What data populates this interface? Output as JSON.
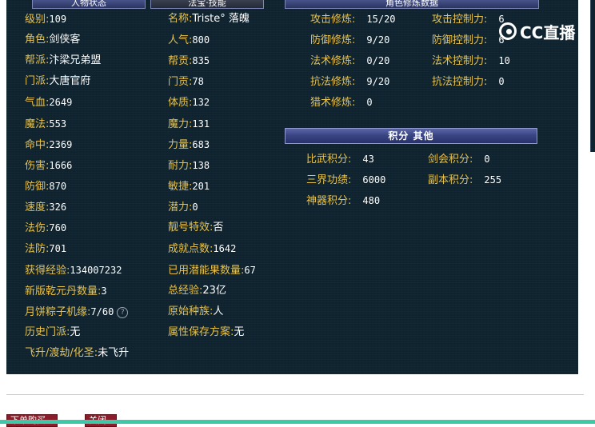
{
  "tabs": [
    {
      "label": "人物状态"
    },
    {
      "label": "法宝·技能"
    },
    {
      "label": "角色修炼数据"
    }
  ],
  "watermark": "CC直播",
  "basic_stats": [
    {
      "label": "级别:",
      "value": "109"
    },
    {
      "label": "角色:",
      "value": "剑侠客"
    },
    {
      "label": "帮派:",
      "value": "汴梁兄弟盟"
    },
    {
      "label": "门派:",
      "value": "大唐官府"
    },
    {
      "label": "气血:",
      "value": "2649"
    },
    {
      "label": "魔法:",
      "value": "553"
    },
    {
      "label": "命中:",
      "value": "2369"
    },
    {
      "label": "伤害:",
      "value": "1666"
    },
    {
      "label": "防御:",
      "value": "870"
    },
    {
      "label": "速度:",
      "value": "326"
    },
    {
      "label": "法伤:",
      "value": "760"
    },
    {
      "label": "法防:",
      "value": "701"
    },
    {
      "label": "获得经验:",
      "value": "134007232"
    },
    {
      "label": "新版乾元丹数量:",
      "value": "3"
    },
    {
      "label": "月饼粽子机缘:",
      "value": "7/60"
    },
    {
      "label": "历史门派:",
      "value": "无"
    },
    {
      "label": "飞升/渡劫/化圣:",
      "value": "未飞升"
    }
  ],
  "detail_stats": [
    {
      "label": "名称:",
      "value": "Triste° 落魄"
    },
    {
      "label": "人气:",
      "value": "800"
    },
    {
      "label": "帮贡:",
      "value": "835"
    },
    {
      "label": "门贡:",
      "value": "78"
    },
    {
      "label": "体质:",
      "value": "132"
    },
    {
      "label": "魔力:",
      "value": "131"
    },
    {
      "label": "力量:",
      "value": "683"
    },
    {
      "label": "耐力:",
      "value": "138"
    },
    {
      "label": "敏捷:",
      "value": "201"
    },
    {
      "label": "潜力:",
      "value": "0"
    },
    {
      "label": "靓号特效:",
      "value": "否"
    },
    {
      "label": "成就点数:",
      "value": "1642"
    },
    {
      "label": "已用潜能果数量:",
      "value": "67"
    },
    {
      "label": "总经验:",
      "value": "23亿"
    },
    {
      "label": "原始种族:",
      "value": "人"
    },
    {
      "label": "属性保存方案:",
      "value": "无"
    }
  ],
  "cultivation": [
    {
      "label": "攻击修炼:",
      "value": "15/20"
    },
    {
      "label": "防御修炼:",
      "value": "9/20"
    },
    {
      "label": "法术修炼:",
      "value": "0/20"
    },
    {
      "label": "抗法修炼:",
      "value": "9/20"
    },
    {
      "label": "猎术修炼:",
      "value": "0"
    }
  ],
  "control": [
    {
      "label": "攻击控制力:",
      "value": "6"
    },
    {
      "label": "防御控制力:",
      "value": "6"
    },
    {
      "label": "法术控制力:",
      "value": "10"
    },
    {
      "label": "抗法控制力:",
      "value": "0"
    }
  ],
  "score_section_title": "积分 其他",
  "scores": [
    {
      "label": "比武积分:",
      "value": "43"
    },
    {
      "label": "剑会积分:",
      "value": "0"
    },
    {
      "label": "三界功绩:",
      "value": "6000"
    },
    {
      "label": "副本积分:",
      "value": "255"
    },
    {
      "label": "神器积分:",
      "value": "480"
    }
  ],
  "buttons": [
    {
      "label": "下单购买"
    },
    {
      "label": "关闭"
    }
  ]
}
